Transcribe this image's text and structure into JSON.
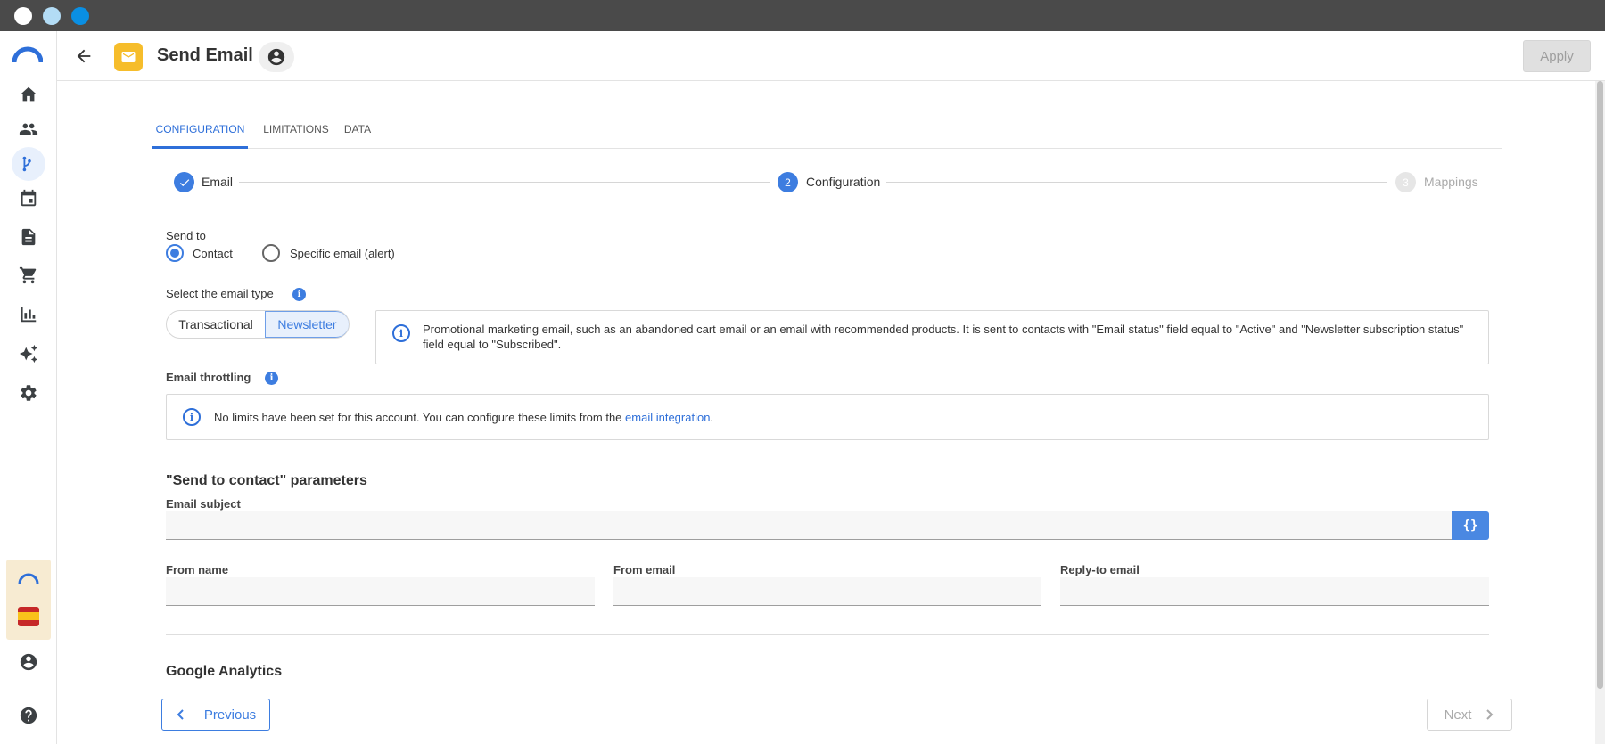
{
  "header": {
    "title": "Send Email",
    "apply_label": "Apply"
  },
  "tabs": [
    {
      "label": "CONFIGURATION",
      "active": true
    },
    {
      "label": "LIMITATIONS",
      "active": false
    },
    {
      "label": "DATA",
      "active": false
    }
  ],
  "stepper": [
    {
      "number": "1",
      "label": "Email",
      "state": "done"
    },
    {
      "number": "2",
      "label": "Configuration",
      "state": "active"
    },
    {
      "number": "3",
      "label": "Mappings",
      "state": "disabled"
    }
  ],
  "send_to": {
    "label": "Send to",
    "options": [
      {
        "label": "Contact",
        "checked": true
      },
      {
        "label": "Specific email (alert)",
        "checked": false
      }
    ]
  },
  "email_type": {
    "label": "Select the email type",
    "options": [
      {
        "label": "Transactional",
        "selected": false
      },
      {
        "label": "Newsletter",
        "selected": true
      }
    ],
    "info_text": "Promotional marketing email, such as an abandoned cart email or an email with recommended products. It is sent to contacts with \"Email status\" field equal to \"Active\" and \"Newsletter subscription status\" field equal to \"Subscribed\"."
  },
  "throttling": {
    "label": "Email throttling",
    "info_text": "No limits have been set for this account. You can configure these limits from the",
    "link_text": "email integration",
    "info_suffix": "."
  },
  "params": {
    "title": "\"Send to contact\" parameters",
    "subject_label": "Email subject",
    "subject_value": "",
    "braces_label": "{}",
    "from_name_label": "From name",
    "from_name_value": "",
    "from_email_label": "From email",
    "from_email_value": "",
    "reply_to_label": "Reply-to email",
    "reply_to_value": ""
  },
  "analytics": {
    "title": "Google Analytics"
  },
  "footer": {
    "previous_label": "Previous",
    "next_label": "Next"
  },
  "colors": {
    "accent": "#3d7de0",
    "mail_badge": "#f6bd2b",
    "titlebar": "#4a4a4a"
  },
  "icons": {
    "sidebar": [
      "home-icon",
      "people-icon",
      "workflow-icon",
      "calendar-icon",
      "document-icon",
      "cart-icon",
      "chart-icon",
      "sparkle-icon",
      "gear-icon"
    ],
    "sidebar_bottom": [
      "account-icon",
      "help-icon"
    ]
  }
}
